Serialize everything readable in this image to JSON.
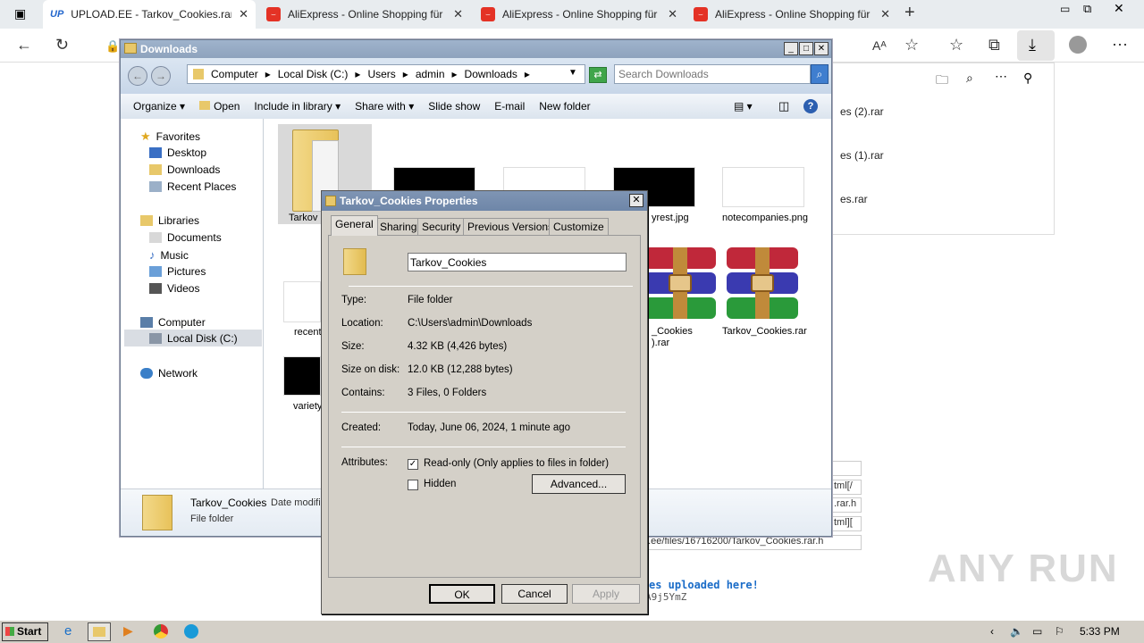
{
  "browser": {
    "tabs": [
      {
        "label": "UPLOAD.EE - Tarkov_Cookies.rar",
        "icon": "uploadee-icon"
      },
      {
        "label": "AliExpress - Online Shopping für",
        "icon": "aliexpress-icon"
      },
      {
        "label": "AliExpress - Online Shopping für",
        "icon": "aliexpress-icon"
      },
      {
        "label": "AliExpress - Online Shopping für",
        "icon": "aliexpress-icon"
      }
    ],
    "tab_favicon_text": "UP",
    "new_tab": "+"
  },
  "downloads_panel": {
    "items": [
      "es (2).rar",
      "es (1).rar",
      "es.rar"
    ]
  },
  "page": {
    "url_rows": [
      "tml[/",
      ".rar.h",
      "tml][",
      "d.ee/files/16716200/Tarkov_Cookies.rar.h"
    ],
    "link_text": "es uploaded here!",
    "code_text": "A9j5YmZ"
  },
  "explorer": {
    "title": "Downloads",
    "breadcrumb": [
      "Computer",
      "Local Disk (C:)",
      "Users",
      "admin",
      "Downloads"
    ],
    "search_placeholder": "Search Downloads",
    "toolbar": {
      "organize": "Organize",
      "open": "Open",
      "include": "Include in library",
      "share": "Share with",
      "slideshow": "Slide show",
      "email": "E-mail",
      "newfolder": "New folder"
    },
    "nav": {
      "favorites": "Favorites",
      "desktop": "Desktop",
      "downloads": "Downloads",
      "recent": "Recent Places",
      "libraries": "Libraries",
      "documents": "Documents",
      "music": "Music",
      "pictures": "Pictures",
      "videos": "Videos",
      "computer": "Computer",
      "localdisk": "Local Disk (C:)",
      "network": "Network"
    },
    "files": {
      "folder": "Tarkov",
      "recent": "recent",
      "variety": "variety",
      "jpg": "yrest.jpg",
      "png": "notecompanies.png",
      "rar1_line1": "_Cookies",
      "rar1_line2": ").rar",
      "rar2": "Tarkov_Cookies.rar"
    },
    "details": {
      "name": "Tarkov_Cookies",
      "date_label": "Date modifi",
      "type": "File folder"
    }
  },
  "dialog": {
    "title": "Tarkov_Cookies Properties",
    "tabs": [
      "General",
      "Sharing",
      "Security",
      "Previous Versions",
      "Customize"
    ],
    "name_value": "Tarkov_Cookies",
    "fields": {
      "type_label": "Type:",
      "type_value": "File folder",
      "location_label": "Location:",
      "location_value": "C:\\Users\\admin\\Downloads",
      "size_label": "Size:",
      "size_value": "4.32 KB (4,426 bytes)",
      "disk_label": "Size on disk:",
      "disk_value": "12.0 KB (12,288 bytes)",
      "contains_label": "Contains:",
      "contains_value": "3 Files, 0 Folders",
      "created_label": "Created:",
      "created_value": "Today, June 06, 2024, 1 minute ago",
      "attributes_label": "Attributes:"
    },
    "readonly_label": "Read-only (Only applies to files in folder)",
    "readonly_checked": true,
    "hidden_label": "Hidden",
    "hidden_checked": false,
    "advanced": "Advanced...",
    "ok": "OK",
    "cancel": "Cancel",
    "apply": "Apply"
  },
  "taskbar": {
    "start": "Start",
    "clock": "5:33 PM"
  },
  "watermark": "ANY RUN"
}
